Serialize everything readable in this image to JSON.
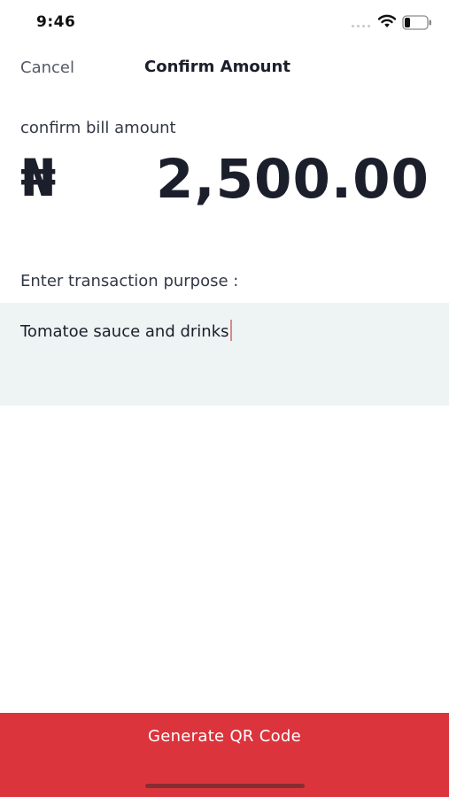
{
  "status_bar": {
    "time": "9:46",
    "icons": [
      "signal-dots-icon",
      "wifi-icon",
      "battery-icon"
    ]
  },
  "nav": {
    "cancel_label": "Cancel",
    "title": "Confirm Amount"
  },
  "bill": {
    "label": "confirm bill amount",
    "currency_symbol": "₦",
    "amount": "2,500.00"
  },
  "purpose": {
    "label": "Enter transaction purpose :",
    "value": "Tomatoe sauce and drinks"
  },
  "actions": {
    "generate_label": "Generate QR Code"
  },
  "colors": {
    "accent": "#dc343c",
    "input_background": "#eef3f4",
    "text_primary": "#1b1e2b"
  }
}
